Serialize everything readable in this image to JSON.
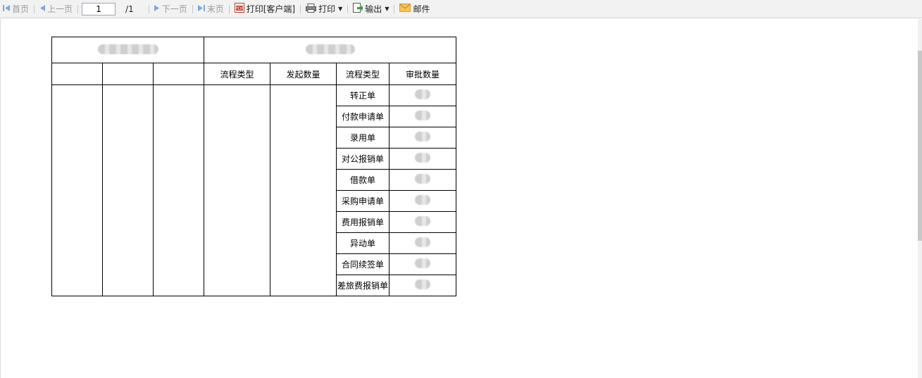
{
  "toolbar": {
    "first": "首页",
    "prev": "上一页",
    "page_value": "1",
    "page_total": "/1",
    "next": "下一页",
    "last": "末页",
    "print_client": "打印[客户端]",
    "print": "打印",
    "export": "输出",
    "mail": "邮件"
  },
  "report": {
    "headers": [
      "流程类型",
      "发起数量",
      "流程类型",
      "审批数量"
    ],
    "flow_types": [
      "转正单",
      "付款申请单",
      "录用单",
      "对公报销单",
      "借款单",
      "采购申请单",
      "费用报销单",
      "异动单",
      "合同续签单",
      "差旅费报销单"
    ]
  },
  "colors": {
    "toolbar_bg": "#f2f2f2",
    "border": "#000000",
    "disabled_text": "#9a9a9a",
    "nav_icon": "#5b9bd5",
    "mail_icon": "#f0a020",
    "pdf_icon": "#c0392b"
  }
}
